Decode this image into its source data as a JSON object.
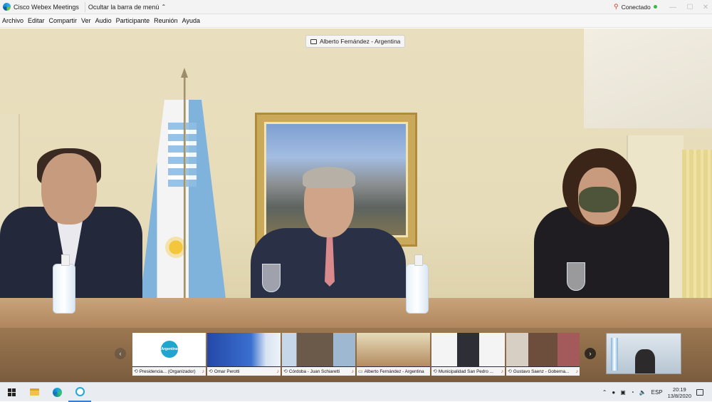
{
  "titlebar": {
    "app_title": "Cisco Webex Meetings",
    "menu_toggle_label": "Ocultar la barra de menú",
    "connection_status": "Conectado",
    "icons": {
      "app": "webex-logo-icon",
      "chevron": "chevron-up-icon",
      "connection": "connection-mic-icon",
      "status": "status-dot-icon"
    }
  },
  "menubar": {
    "items": [
      "Archivo",
      "Editar",
      "Compartir",
      "Ver",
      "Audio",
      "Participante",
      "Reunión",
      "Ayuda"
    ]
  },
  "stage": {
    "active_speaker": "Alberto Fernández - Argentina"
  },
  "filmstrip": {
    "tiles": [
      {
        "label": "Presidencia... (Organizador)",
        "logo_text": "Argentina"
      },
      {
        "label": "Omar Perotti"
      },
      {
        "label": "Córdoba - Juan Schiaretti"
      },
      {
        "label": "Alberto Fernández - Argentina"
      },
      {
        "label": "Municipalidad San Pedro ..."
      },
      {
        "label": "Gustavo Saenz - Goberna..."
      }
    ],
    "prev_icon": "chevron-left-icon",
    "next_icon": "chevron-right-icon"
  },
  "taskbar": {
    "language": "ESP",
    "time": "20:19",
    "date": "13/8/2020",
    "icons": [
      "windows-start-icon",
      "file-explorer-icon",
      "edge-browser-icon",
      "webex-app-icon"
    ]
  },
  "colors": {
    "flag_blue": "#7fb3dc",
    "status_green": "#3bb54a",
    "mic_red": "#c94434"
  }
}
